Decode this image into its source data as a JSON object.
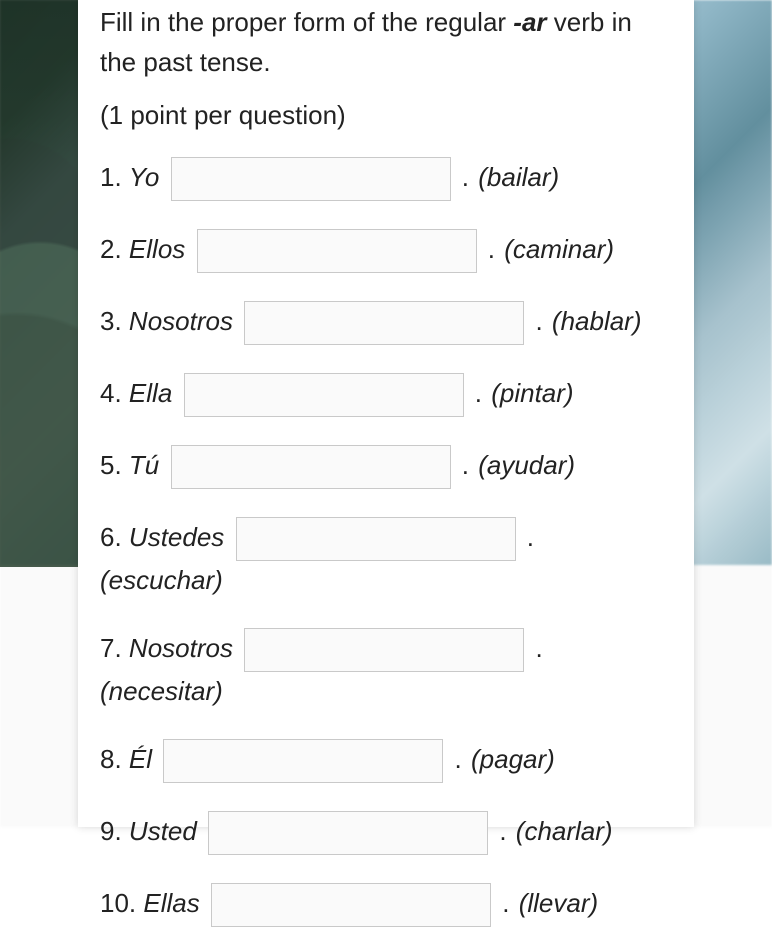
{
  "instructions": {
    "pre": "Fill in the proper form of the regular ",
    "boldItalic": "-ar",
    "post": " verb in the past tense."
  },
  "points_text": "(1 point per question)",
  "questions": [
    {
      "num": "1.",
      "subject": "Yo",
      "infinitive": "(bailar)",
      "value": ""
    },
    {
      "num": "2.",
      "subject": "Ellos",
      "infinitive": "(caminar)",
      "value": ""
    },
    {
      "num": "3.",
      "subject": "Nosotros",
      "infinitive": "(hablar)",
      "value": ""
    },
    {
      "num": "4.",
      "subject": "Ella",
      "infinitive": "(pintar)",
      "value": ""
    },
    {
      "num": "5.",
      "subject": "Tú",
      "infinitive": "(ayudar)",
      "value": ""
    },
    {
      "num": "6.",
      "subject": "Ustedes",
      "infinitive": "(escuchar)",
      "value": ""
    },
    {
      "num": "7.",
      "subject": "Nosotros",
      "infinitive": "(necesitar)",
      "value": ""
    },
    {
      "num": "8.",
      "subject": "Él",
      "infinitive": "(pagar)",
      "value": ""
    },
    {
      "num": "9.",
      "subject": "Usted",
      "infinitive": "(charlar)",
      "value": ""
    },
    {
      "num": "10.",
      "subject": "Ellas",
      "infinitive": "(llevar)",
      "value": ""
    }
  ],
  "period": "."
}
